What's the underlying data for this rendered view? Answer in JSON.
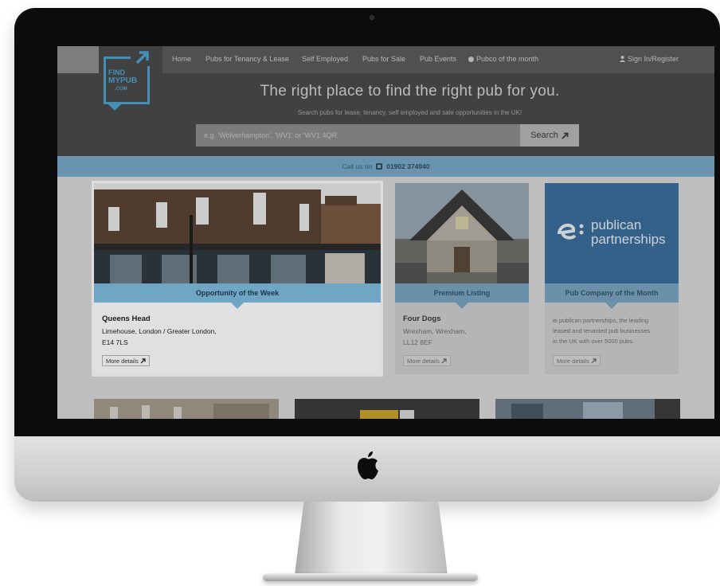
{
  "nav": {
    "home": "Home",
    "tenancy": "Pubs for Tenancy & Lease",
    "self_employed": "Self Employed",
    "for_sale": "Pubs for Sale",
    "events": "Pub Events",
    "pubco": "Pubco of the month",
    "sign_in": "Sign In/Register"
  },
  "logo": {
    "line1": "FIND",
    "line2": "MYPUB",
    "line3": ".COM"
  },
  "hero": {
    "title": "The right place to find the right pub for you.",
    "subtitle": "Search pubs for lease, tenancy, self employed and sale opportunities in the UK!"
  },
  "search": {
    "placeholder": "e.g. 'Wolverhampton', 'WV1' or 'WV1 4QR'",
    "button_label": "Search"
  },
  "callbar": {
    "label": "Call us on",
    "phone": "01902 374940"
  },
  "cards": [
    {
      "banner": "Opportunity of the Week",
      "title": "Queens Head",
      "line1": "Limehouse, London / Greater London,",
      "line2": "E14 7LS",
      "button": "More details"
    },
    {
      "banner": "Premium Listing",
      "title": "Four Dogs",
      "line1": "Wrexham, Wrexham,",
      "line2": "LL12 8EF",
      "button": "More details"
    },
    {
      "banner": "Pub Company of the Month",
      "logo_line1": "publican",
      "logo_line2": "partnerships",
      "line1": "ei publican partnerships, the leading",
      "line2": "leased and tenanted pub businesses",
      "line3": "in the UK with over 5000 pubs.",
      "button": "More details"
    }
  ],
  "colors": {
    "accent_blue": "#4fa2d0",
    "hero_dark": "#4a4a4a",
    "callbar": "#78a8c6"
  }
}
